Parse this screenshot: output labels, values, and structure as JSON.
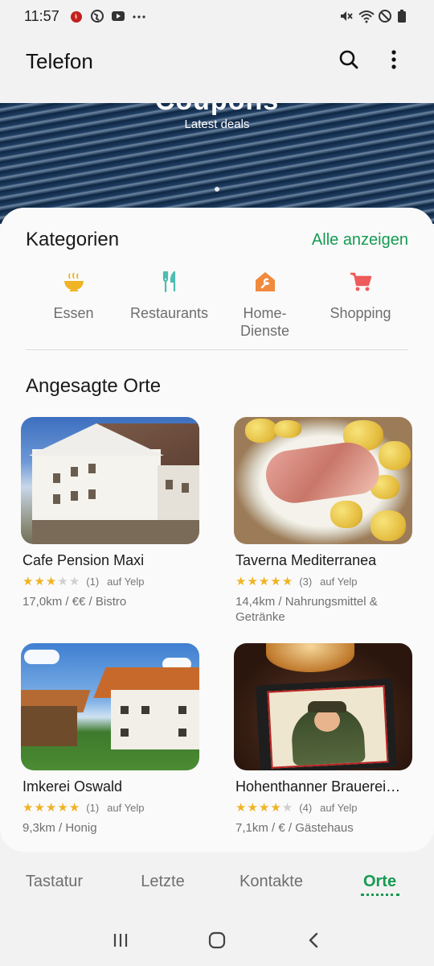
{
  "status": {
    "time": "11:57",
    "left_icons": [
      "fire-app-icon",
      "globe-icon",
      "youtube-icon",
      "more-dots-icon"
    ],
    "right_icons": [
      "mute-icon",
      "wifi-icon",
      "do-not-disturb-icon",
      "battery-icon"
    ]
  },
  "appbar": {
    "title": "Telefon",
    "icons": [
      "search-icon",
      "more-vert-icon"
    ]
  },
  "banner": {
    "title": "Coupons",
    "subtitle": "Latest deals"
  },
  "categories": {
    "title": "Kategorien",
    "link": "Alle anzeigen",
    "items": [
      {
        "label": "Essen",
        "icon": "bowl-icon",
        "color": "#f0b323"
      },
      {
        "label": "Restaurants",
        "icon": "cutlery-icon",
        "color": "#4dbdb0"
      },
      {
        "label": "Home-\nDienste",
        "icon": "wrench-icon",
        "color": "#f08a3c"
      },
      {
        "label": "Shopping",
        "icon": "cart-icon",
        "color": "#ef5a5a"
      }
    ]
  },
  "places": {
    "title": "Angesagte Orte",
    "items": [
      {
        "name": "Cafe Pension Maxi",
        "stars": 3,
        "count": "(1)",
        "source": "auf Yelp",
        "info": "17,0km / €€ / Bistro"
      },
      {
        "name": "Taverna Mediterranea",
        "stars": 5,
        "count": "(3)",
        "source": "auf Yelp",
        "info": "14,4km / Nahrungsmittel & Getränke"
      },
      {
        "name": "Imkerei Oswald",
        "stars": 5,
        "count": "(1)",
        "source": "auf Yelp",
        "info": "9,3km / Honig"
      },
      {
        "name": "Hohenthanner Brauerei…",
        "stars": 4,
        "count": "(4)",
        "source": "auf Yelp",
        "info": "7,1km / € / Gästehaus"
      }
    ]
  },
  "tabs": [
    {
      "label": "Tastatur",
      "active": false
    },
    {
      "label": "Letzte",
      "active": false
    },
    {
      "label": "Kontakte",
      "active": false
    },
    {
      "label": "Orte",
      "active": true
    }
  ],
  "colors": {
    "accent": "#169a52",
    "star": "#f0b323"
  },
  "navbar": [
    "recents-icon",
    "home-icon",
    "back-icon"
  ]
}
